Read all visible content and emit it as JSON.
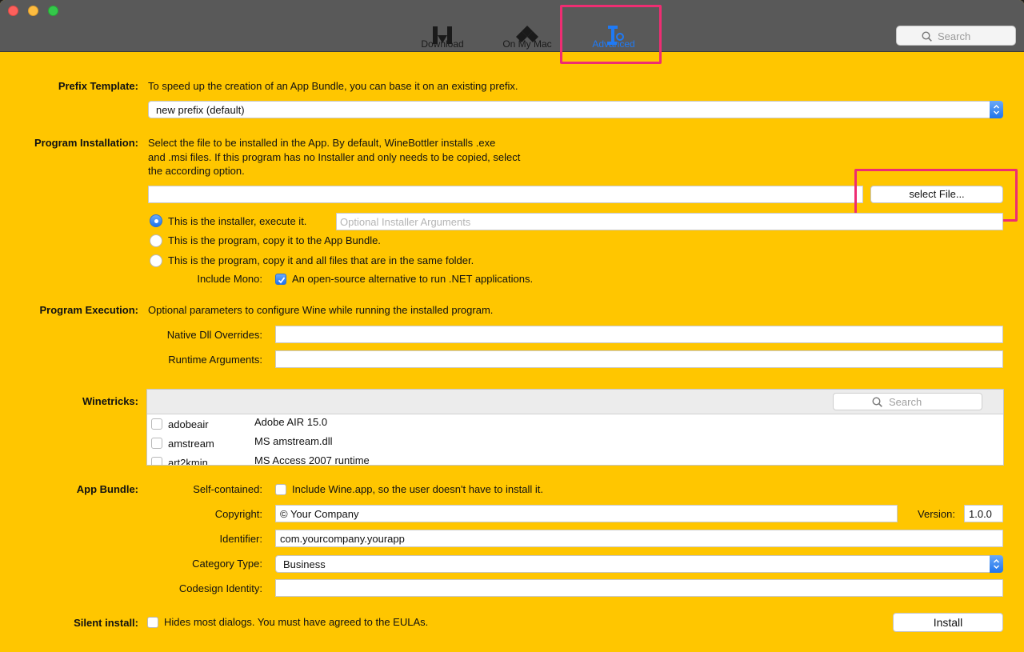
{
  "toolbar": {
    "tabs": [
      {
        "label": "Download",
        "icon": "download-icon"
      },
      {
        "label": "On My Mac",
        "icon": "on-my-mac-icon"
      },
      {
        "label": "Advanced",
        "icon": "advanced-icon",
        "active": true
      }
    ],
    "search_placeholder": "Search"
  },
  "prefix_template": {
    "label": "Prefix Template:",
    "description": "To speed up the creation of an App Bundle, you can base it on an existing prefix.",
    "selected": "new prefix (default)"
  },
  "program_installation": {
    "label": "Program Installation:",
    "description": [
      "Select the file to be installed in the App. By default, WineBottler installs .exe",
      "and .msi files. If this program has no Installer and only needs to be copied, select",
      "the according option."
    ],
    "file_path": "",
    "select_file_label": "select File...",
    "options": [
      {
        "label": "This is the installer, execute it.",
        "selected": true
      },
      {
        "label": "This is the program, copy it to the App Bundle.",
        "selected": false
      },
      {
        "label": "This is the program, copy it and all files that are in the same folder.",
        "selected": false
      }
    ],
    "installer_args_placeholder": "Optional Installer Arguments",
    "mono_label": "Include Mono:",
    "mono_checkbox_label": "An open-source alternative to run .NET applications.",
    "mono_checked": true
  },
  "program_execution": {
    "label": "Program Execution:",
    "description": "Optional parameters to configure Wine while running the installed program.",
    "dll_overrides_label": "Native Dll Overrides:",
    "dll_overrides_value": "",
    "runtime_args_label": "Runtime Arguments:",
    "runtime_args_value": ""
  },
  "winetricks": {
    "label": "Winetricks:",
    "search_placeholder": "Search",
    "items": [
      {
        "name": "adobeair",
        "description": "Adobe AIR 15.0",
        "checked": false
      },
      {
        "name": "amstream",
        "description": "MS amstream.dll",
        "checked": false
      },
      {
        "name": "art2kmin",
        "description": "MS Access 2007 runtime",
        "checked": false
      }
    ]
  },
  "app_bundle": {
    "label": "App Bundle:",
    "self_contained_label": "Self-contained:",
    "self_contained_checkbox_label": "Include Wine.app, so the user doesn't have to install it.",
    "self_contained_checked": false,
    "copyright_label": "Copyright:",
    "copyright_value": "© Your Company",
    "version_label": "Version:",
    "version_value": "1.0.0",
    "identifier_label": "Identifier:",
    "identifier_value": "com.yourcompany.yourapp",
    "category_label": "Category Type:",
    "category_value": "Business",
    "codesign_label": "Codesign Identity:",
    "codesign_value": ""
  },
  "silent_install": {
    "label": "Silent install:",
    "checkbox_label": "Hides most dialogs. You must have agreed to the EULAs.",
    "checked": false
  },
  "install_button_label": "Install",
  "colors": {
    "background": "#ffc600",
    "toolbar": "#595959",
    "accent": "#1f74ec",
    "highlight": "#ee2d72"
  }
}
